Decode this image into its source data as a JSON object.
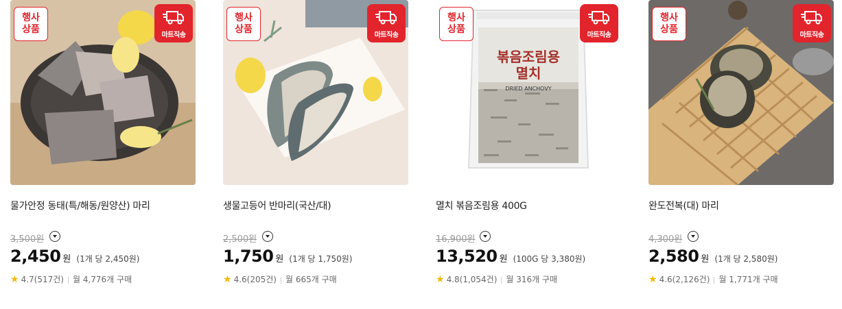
{
  "badges": {
    "event_line1": "행사",
    "event_line2": "상품",
    "mart": "마트직송"
  },
  "currency": "원",
  "products": [
    {
      "name": "물가안정 동태(특/해동/원양산) 마리",
      "original_price": "3,500원",
      "price": "2,450",
      "unit_price": "(1개 당 2,450원)",
      "rating": "4.7(517건)",
      "monthly": "월 4,776개 구매",
      "image_icon": "pollack-fish-image"
    },
    {
      "name": "생물고등어 반마리(국산/대)",
      "original_price": "2,500원",
      "price": "1,750",
      "unit_price": "(1개 당 1,750원)",
      "rating": "4.6(205건)",
      "monthly": "월 665개 구매",
      "image_icon": "mackerel-fish-image"
    },
    {
      "name": "멸치 볶음조림용 400G",
      "original_price": "16,900원",
      "price": "13,520",
      "unit_price": "(100G 당 3,380원)",
      "rating": "4.8(1,054건)",
      "monthly": "월 316개 구매",
      "image_icon": "dried-anchovy-bag-image",
      "package_text": {
        "title1": "볶음조림용",
        "title2": "멸치",
        "sub": "DRIED ANCHOVY"
      }
    },
    {
      "name": "완도전복(대) 마리",
      "original_price": "4,300원",
      "price": "2,580",
      "unit_price": "(1개 당 2,580원)",
      "rating": "4.6(2,126건)",
      "monthly": "월 1,771개 구매",
      "image_icon": "abalone-image"
    }
  ],
  "colors": {
    "accent_red": "#e2242c",
    "star": "#f5b800"
  }
}
